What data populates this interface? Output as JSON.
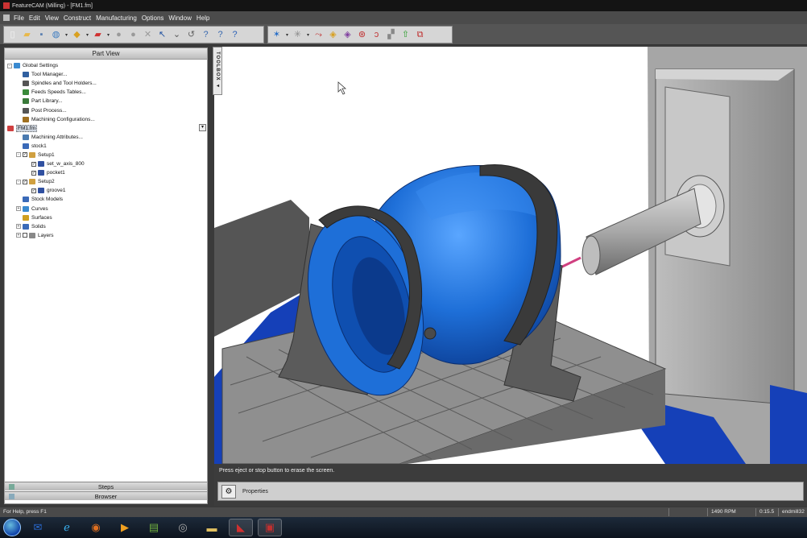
{
  "window": {
    "title": "FeatureCAM (Milling) - [FM1.fm]"
  },
  "menu": [
    "File",
    "Edit",
    "View",
    "Construct",
    "Manufacturing",
    "Options",
    "Window",
    "Help"
  ],
  "toolbar": {
    "buttons": [
      {
        "name": "new-file",
        "glyph": "▯",
        "color": "#f4f4f4"
      },
      {
        "name": "open-folder",
        "glyph": "▰",
        "color": "#e8b84a"
      },
      {
        "name": "save",
        "glyph": "▪",
        "color": "#5a7fb0"
      },
      {
        "name": "globe",
        "glyph": "◍",
        "color": "#3a7ac0"
      },
      {
        "name": "shading",
        "glyph": "◆",
        "color": "#d9a020"
      },
      {
        "name": "eraser",
        "glyph": "▰",
        "color": "#d03030"
      },
      {
        "name": "circle-a",
        "glyph": "●",
        "color": "#9a9a9a"
      },
      {
        "name": "circle-b",
        "glyph": "●",
        "color": "#9a9a9a"
      },
      {
        "name": "cross",
        "glyph": "✕",
        "color": "#9a9a9a"
      },
      {
        "name": "select-pointer",
        "glyph": "↖",
        "color": "#2050a0"
      },
      {
        "name": "cursor-drop",
        "glyph": "⌄",
        "color": "#555"
      },
      {
        "name": "wand",
        "glyph": "↺",
        "color": "#666"
      },
      {
        "name": "context-help",
        "glyph": "?",
        "color": "#3a6ab0"
      },
      {
        "name": "help-query",
        "glyph": "?",
        "color": "#3a6ab0"
      },
      {
        "name": "help",
        "glyph": "?",
        "color": "#2d62b8"
      },
      {
        "name": "star",
        "glyph": "✶",
        "color": "#2a70c8"
      },
      {
        "name": "sparkle",
        "glyph": "✳",
        "color": "#888"
      },
      {
        "name": "toolpath",
        "glyph": "⤳",
        "color": "#c03030"
      },
      {
        "name": "cube-a",
        "glyph": "◈",
        "color": "#d8a020"
      },
      {
        "name": "cube-b",
        "glyph": "◈",
        "color": "#8040a0"
      },
      {
        "name": "simulate",
        "glyph": "⊛",
        "color": "#c03030"
      },
      {
        "name": "sim-2",
        "glyph": "ↄ",
        "color": "#c03030"
      },
      {
        "name": "sim-3",
        "glyph": "▞",
        "color": "#888"
      },
      {
        "name": "sim-4",
        "glyph": "⇧",
        "color": "#30a030"
      },
      {
        "name": "sim-5",
        "glyph": "⧉",
        "color": "#c03030"
      }
    ]
  },
  "part_view": {
    "header": "Part View",
    "tree": [
      {
        "label": "Global Settings",
        "level": 0,
        "exp": "-",
        "icon": "globe-icon",
        "color": "#3a8ad0"
      },
      {
        "label": "Tool Manager...",
        "level": 1,
        "icon": "tool-manager-icon",
        "color": "#3060a0"
      },
      {
        "label": "Spindles and Tool Holders...",
        "level": 1,
        "icon": "spindle-icon",
        "color": "#555"
      },
      {
        "label": "Feeds  Speeds Tables...",
        "level": 1,
        "icon": "feeds-icon",
        "color": "#3a8a3a"
      },
      {
        "label": "Part Library...",
        "level": 1,
        "icon": "library-icon",
        "color": "#3a7a3a"
      },
      {
        "label": "Post Process...",
        "level": 1,
        "icon": "post-icon",
        "color": "#555"
      },
      {
        "label": "Machining Configurations...",
        "level": 1,
        "icon": "machine-config-icon",
        "color": "#a07020"
      },
      {
        "label": "FM1.fm",
        "level": 0,
        "icon": "file-icon",
        "color": "#d04040",
        "selected": true
      },
      {
        "label": "Machining Attributes...",
        "level": 1,
        "icon": "attributes-icon",
        "color": "#4a7ab0"
      },
      {
        "label": "stock1",
        "level": 1,
        "icon": "stock-icon",
        "color": "#3a6ab8"
      },
      {
        "label": "Setup1",
        "level": 1,
        "exp": "-",
        "check": true,
        "icon": "setup-icon",
        "color": "#d0a040"
      },
      {
        "label": "set_w_axis_800",
        "level": 2,
        "check": true,
        "icon": "feature-icon",
        "color": "#3050a0"
      },
      {
        "label": "pocket1",
        "level": 2,
        "check": true,
        "icon": "feature-icon",
        "color": "#3050a0"
      },
      {
        "label": "Setup2",
        "level": 1,
        "exp": "-",
        "check": true,
        "icon": "setup-icon",
        "color": "#d0a040"
      },
      {
        "label": "groove1",
        "level": 2,
        "check": true,
        "icon": "feature-icon",
        "color": "#3050a0"
      },
      {
        "label": "Stock Models",
        "level": 1,
        "icon": "stock-models-icon",
        "color": "#3a6ab8"
      },
      {
        "label": "Curves",
        "level": 1,
        "exp": "+",
        "icon": "curve-icon",
        "color": "#3a8ad0"
      },
      {
        "label": "Surfaces",
        "level": 1,
        "icon": "surface-icon",
        "color": "#d0a020"
      },
      {
        "label": "Solids",
        "level": 1,
        "exp": "+",
        "icon": "solid-icon",
        "color": "#3a6ab8"
      },
      {
        "label": "Layers",
        "level": 1,
        "exp": "+",
        "check": false,
        "icon": "layers-icon",
        "color": "#888"
      }
    ],
    "dropdown_glyph": "▾"
  },
  "left_tabs": {
    "steps": "Steps",
    "browser": "Browser"
  },
  "toolbox": {
    "label": "TOOLBOX ◂"
  },
  "message": "Press eject or stop button to erase the screen.",
  "properties": {
    "label": "Properties"
  },
  "status": {
    "help": "For Help, press F1",
    "rpm": "1490 RPM",
    "time": "0:15.5",
    "tool": "endmill32"
  },
  "taskbar": [
    {
      "name": "start-orb",
      "glyph": ""
    },
    {
      "name": "outlook",
      "glyph": "✉",
      "color": "#2a6ad0"
    },
    {
      "name": "internet-explorer",
      "glyph": "ℯ",
      "color": "#3ab0f0"
    },
    {
      "name": "firefox",
      "glyph": "◉",
      "color": "#e07020"
    },
    {
      "name": "media-player",
      "glyph": "▶",
      "color": "#f0a020"
    },
    {
      "name": "notepad",
      "glyph": "▤",
      "color": "#70b040"
    },
    {
      "name": "disk-utility",
      "glyph": "◎",
      "color": "#aaa"
    },
    {
      "name": "explorer",
      "glyph": "▬",
      "color": "#e0c060"
    },
    {
      "name": "featurecam",
      "glyph": "◣",
      "color": "#d03030",
      "active": true
    },
    {
      "name": "adobe-pdf",
      "glyph": "▣",
      "color": "#c03030",
      "active": true
    }
  ],
  "colors": {
    "part_blue": "#1e6fd8",
    "machine_gray": "#9a9a9a",
    "table_blue": "#1540b8"
  }
}
